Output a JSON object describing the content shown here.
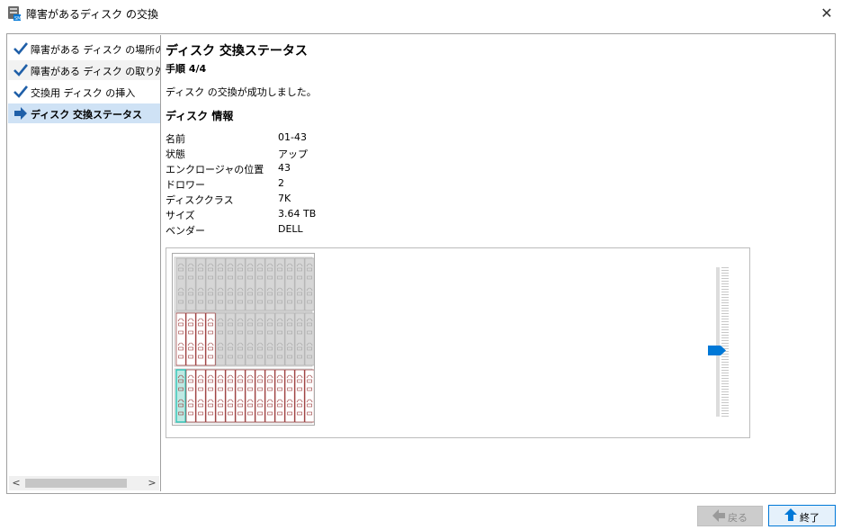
{
  "window": {
    "title": "障害があるディスク の交換",
    "icon": "server-disk-icon",
    "close_glyph": "✕"
  },
  "sidebar": {
    "items": [
      {
        "label": "障害がある ディスク の場所の特定",
        "icon": "check-icon",
        "state": "done"
      },
      {
        "label": "障害がある ディスク の取り外し",
        "icon": "check-icon",
        "state": "done"
      },
      {
        "label": "交換用 ディスク の挿入",
        "icon": "check-icon",
        "state": "done"
      },
      {
        "label": "ディスク 交換ステータス",
        "icon": "arrow-right-icon",
        "state": "current"
      }
    ],
    "scroll_left": "<",
    "scroll_right": ">"
  },
  "main": {
    "heading": "ディスク 交換ステータス",
    "step": "手順 4/4",
    "message": "ディスク の交換が成功しました。",
    "section_title": "ディスク 情報",
    "info": [
      {
        "label": "名前",
        "value": "01-43"
      },
      {
        "label": "状態",
        "value": "アップ"
      },
      {
        "label": "エンクロージャの位置",
        "value": "43"
      },
      {
        "label": "ドロワー",
        "value": "2"
      },
      {
        "label": "ディスククラス",
        "value": "7K"
      },
      {
        "label": "サイズ",
        "value": "3.64 TB"
      },
      {
        "label": "ベンダー",
        "value": "DELL"
      }
    ]
  },
  "enclosure_view": {
    "drawers": 3,
    "slots_per_drawer": 14,
    "drawer_1_populated": 0,
    "drawer_2_populated": 4,
    "drawer_3_populated": 14,
    "highlighted_drawer": 3,
    "highlighted_slot": 1
  },
  "buttons": {
    "back": "戻る",
    "finish": "終了"
  },
  "colors": {
    "accent": "#0078d7",
    "check": "#1f5fa8",
    "active_row": "#cfe2f5",
    "highlight_slot": "#2ec4b6",
    "disk_outline": "#8b1a1a"
  }
}
